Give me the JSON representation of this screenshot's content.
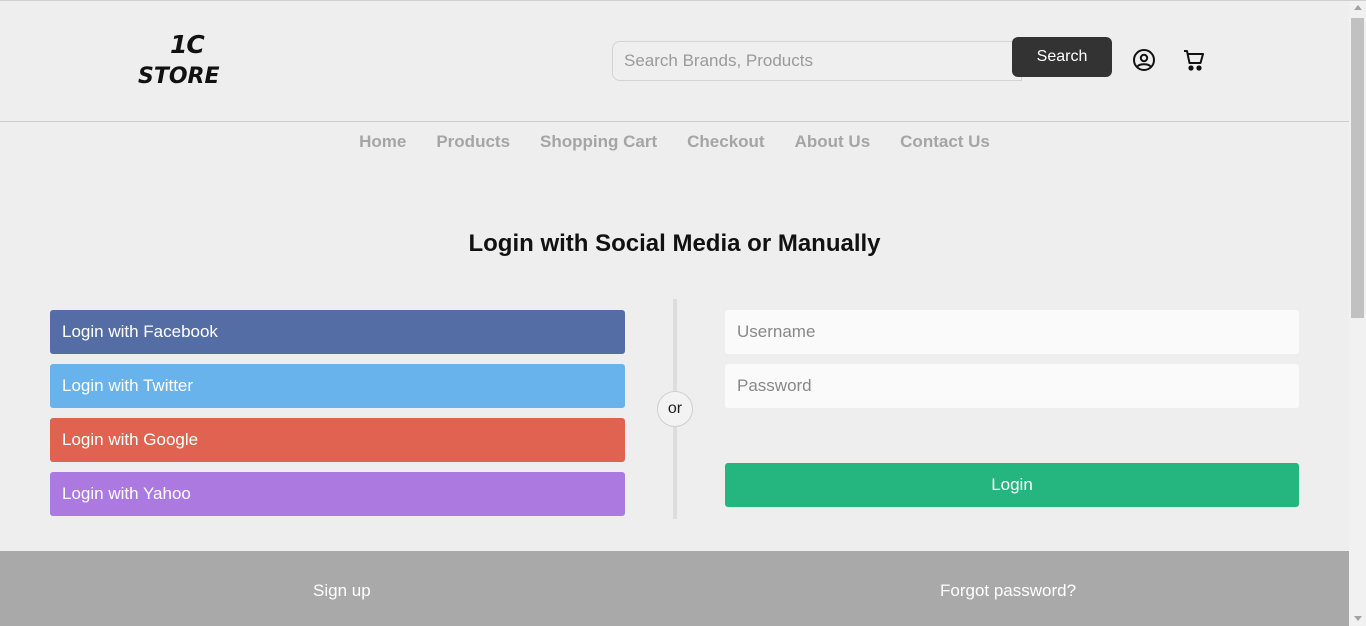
{
  "brand": {
    "line1": "1C",
    "line2": "STORE"
  },
  "search": {
    "placeholder": "Search Brands, Products",
    "value": "",
    "button_label": "Search"
  },
  "header_icons": [
    "user-circle-icon",
    "shopping-cart-icon"
  ],
  "nav": {
    "items": [
      "Home",
      "Products",
      "Shopping Cart",
      "Checkout",
      "About Us",
      "Contact Us"
    ]
  },
  "login": {
    "title": "Login with Social Media or Manually",
    "social": [
      {
        "label": "Login with Facebook",
        "color": "#546ea5"
      },
      {
        "label": "Login with Twitter",
        "color": "#68b3eb"
      },
      {
        "label": "Login with Google",
        "color": "#e06352"
      },
      {
        "label": "Login with Yahoo",
        "color": "#ab79df"
      }
    ],
    "or_label": "or",
    "username_placeholder": "Username",
    "password_placeholder": "Password",
    "login_button": "Login",
    "login_color": "#25b57f"
  },
  "footer_bar": {
    "signup": "Sign up",
    "forgot": "Forgot password?"
  }
}
